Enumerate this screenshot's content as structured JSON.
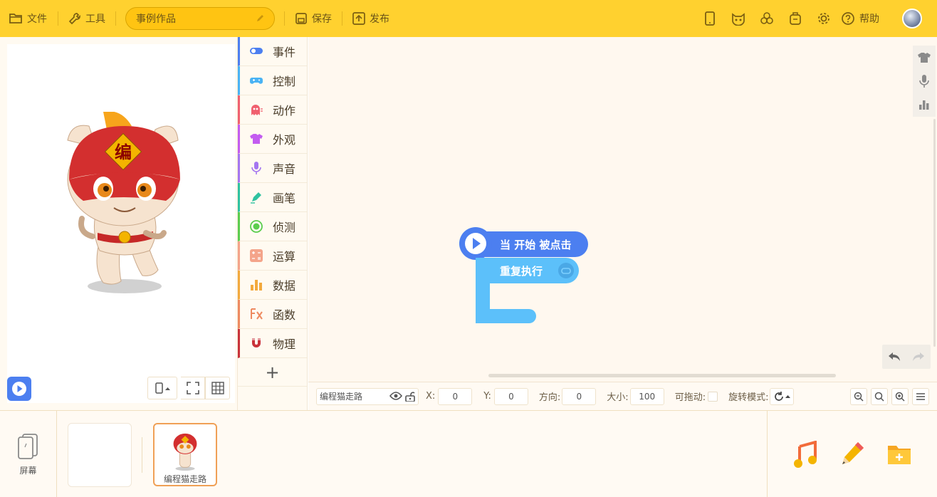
{
  "topbar": {
    "file_label": "文件",
    "tools_label": "工具",
    "project_name": "事例作品",
    "save_label": "保存",
    "publish_label": "发布",
    "help_label": "帮助"
  },
  "categories": [
    {
      "label": "事件",
      "color": "#4c7ff0",
      "icon": "toggle-icon"
    },
    {
      "label": "控制",
      "color": "#4ab3f4",
      "icon": "gamepad-icon"
    },
    {
      "label": "动作",
      "color": "#f0606f",
      "icon": "ghost-icon"
    },
    {
      "label": "外观",
      "color": "#c35cf0",
      "icon": "shirt-icon"
    },
    {
      "label": "声音",
      "color": "#a476f0",
      "icon": "microphone-icon"
    },
    {
      "label": "画笔",
      "color": "#2fc2a0",
      "icon": "pen-icon"
    },
    {
      "label": "侦测",
      "color": "#5bcd4e",
      "icon": "target-icon"
    },
    {
      "label": "运算",
      "color": "#f4a48a",
      "icon": "calculator-icon"
    },
    {
      "label": "数据",
      "color": "#f3a93d",
      "icon": "bar-chart-icon"
    },
    {
      "label": "函数",
      "color": "#ee8a60",
      "icon": "function-icon"
    },
    {
      "label": "物理",
      "color": "#c9323a",
      "icon": "magnet-icon"
    }
  ],
  "add_category": "+",
  "blocks": {
    "hat": "当 开始 被点击",
    "repeat": "重复执行"
  },
  "sprite_props": {
    "name": "编程猫走路",
    "x_label": "X:",
    "x": "0",
    "y_label": "Y:",
    "y": "0",
    "direction_label": "方向:",
    "direction": "0",
    "size_label": "大小:",
    "size": "100",
    "draggable_label": "可拖动:",
    "rotation_label": "旋转模式:"
  },
  "bottom": {
    "screen_label": "屏幕",
    "sprite_label": "编程猫走路"
  },
  "sprite_badge": "编",
  "colors": {
    "topbar": "#ffd12f",
    "workspace": "#fff8ef",
    "hat_block": "#4c7ff0",
    "control_block": "#5cc0fa"
  }
}
